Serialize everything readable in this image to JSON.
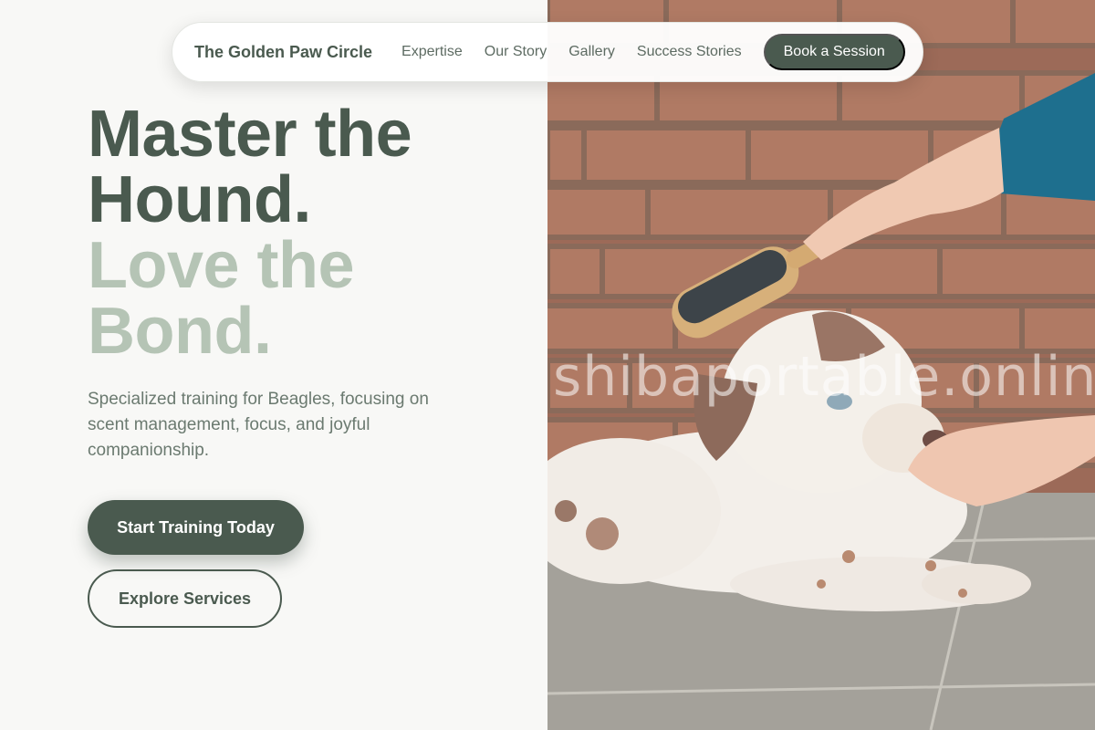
{
  "nav": {
    "brand": "The Golden Paw Circle",
    "links": [
      "Expertise",
      "Our Story",
      "Gallery",
      "Success Stories"
    ],
    "cta": "Book a Session"
  },
  "hero": {
    "headline_line1": "Master the",
    "headline_line2": "Hound.",
    "headline_line3": "Love the",
    "headline_line4": "Bond.",
    "subtext": "Specialized training for Beagles, focusing on scent management, focus, and joyful companionship.",
    "primary_button": "Start Training Today",
    "secondary_button": "Explore Services"
  },
  "image": {
    "description_icon": "photo-puppy-brush",
    "watermark": "shibaportable.online"
  },
  "colors": {
    "primary": "#4a5a4f",
    "accent_light": "#b5c4b5",
    "background": "#f8f8f6",
    "text_muted": "#6b7a70"
  }
}
